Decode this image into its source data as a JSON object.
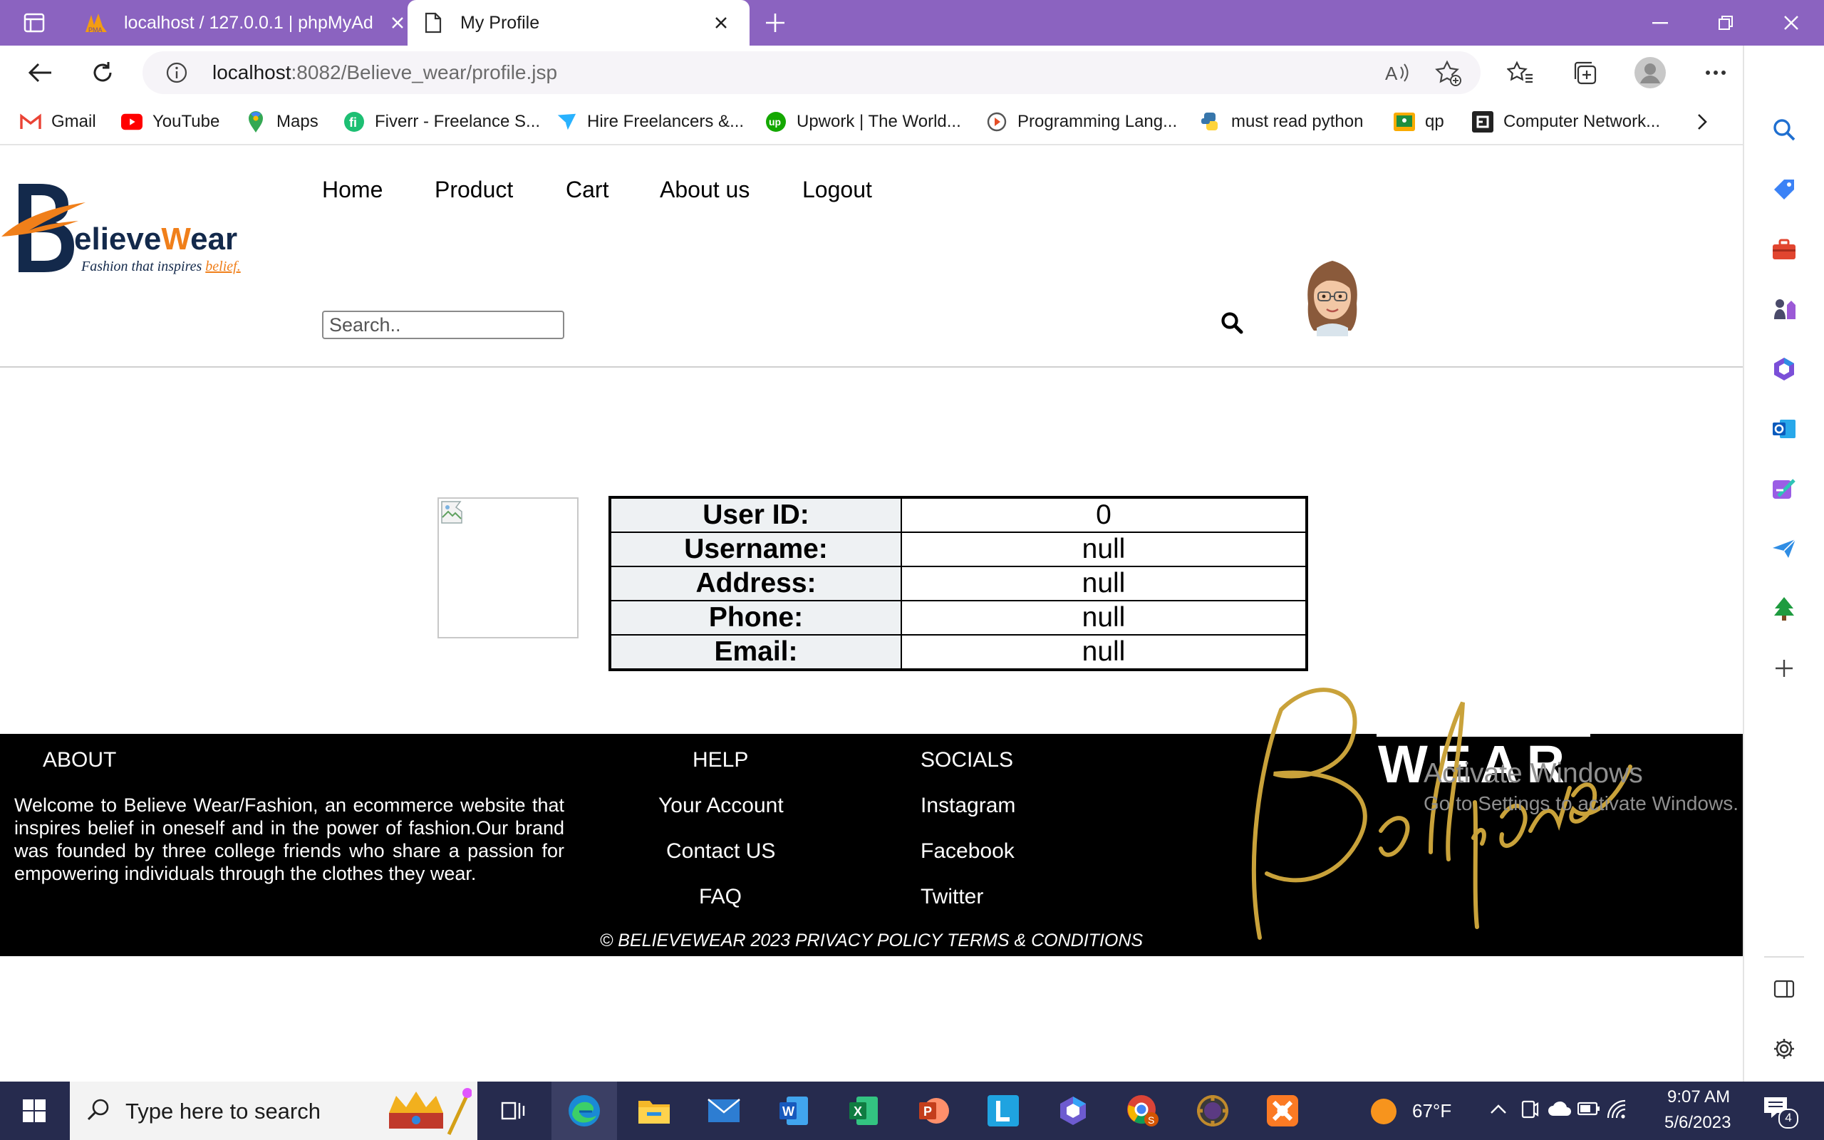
{
  "browser": {
    "tabs": [
      {
        "title": "localhost / 127.0.0.1 | phpMyAdmin",
        "icon": "phpmyadmin-icon",
        "active": false
      },
      {
        "title": "My Profile",
        "icon": "page-icon",
        "active": true
      }
    ],
    "url": {
      "host": "localhost",
      "rest": ":8082/Believe_wear/profile.jsp"
    },
    "bookmarks": [
      {
        "label": "Gmail",
        "icon": "gmail-icon",
        "color": "#ea4335"
      },
      {
        "label": "YouTube",
        "icon": "youtube-icon",
        "color": "#ff0000"
      },
      {
        "label": "Maps",
        "icon": "maps-icon",
        "color": "#34a853"
      },
      {
        "label": "Fiverr - Freelance S...",
        "icon": "fiverr-icon",
        "color": "#1dbf73"
      },
      {
        "label": "Hire Freelancers &...",
        "icon": "freelancer-icon",
        "color": "#29b2fe"
      },
      {
        "label": "Upwork | The World...",
        "icon": "upwork-icon",
        "color": "#14a800"
      },
      {
        "label": "Programming Lang...",
        "icon": "programming-icon",
        "color": "#e44d26"
      },
      {
        "label": "must read python",
        "icon": "python-icon",
        "color": "#3776ab"
      },
      {
        "label": "qp",
        "icon": "classroom-icon",
        "color": "#f9ab00"
      },
      {
        "label": "Computer Network...",
        "icon": "network-icon",
        "color": "#222222"
      }
    ]
  },
  "site": {
    "logo": {
      "brand_b": "B",
      "brand_main": "elieve",
      "brand_w": "W",
      "brand_end": "ear",
      "tagline": "Fashion that inspires",
      "tagline_accent": "belief.",
      "accent": "#f07f1a",
      "navy": "#13294b"
    },
    "nav": [
      "Home",
      "Product",
      "Cart",
      "About us",
      "Logout"
    ],
    "search_placeholder": "Search.."
  },
  "profile": {
    "rows": [
      {
        "label": "User ID:",
        "value": "0"
      },
      {
        "label": "Username:",
        "value": "null"
      },
      {
        "label": "Address:",
        "value": "null"
      },
      {
        "label": "Phone:",
        "value": "null"
      },
      {
        "label": "Email:",
        "value": "null"
      }
    ]
  },
  "footer": {
    "about_heading": "ABOUT",
    "about_text": "Welcome to Believe Wear/Fashion, an ecommerce website that inspires belief in oneself and in the power of fashion.Our brand was founded by three college friends who share a passion for empowering individuals through the clothes they wear.",
    "help_heading": "HELP",
    "help_links": [
      "Your Account",
      "Contact US",
      "FAQ"
    ],
    "socials_heading": "SOCIALS",
    "social_links": [
      "Instagram",
      "Facebook",
      "Twitter"
    ],
    "copyright": "© BELIEVEWEAR 2023 PRIVACY POLICY TERMS & CONDITIONS",
    "brand_word": "WEAR",
    "brand_script": "Believe",
    "gold": "#c9a23a"
  },
  "watermark": {
    "title": "Activate Windows",
    "subtitle": "Go to Settings to activate Windows."
  },
  "taskbar": {
    "search_placeholder": "Type here to search",
    "weather": "67°F",
    "time": "9:07 AM",
    "date": "5/6/2023",
    "notifications": "4"
  }
}
